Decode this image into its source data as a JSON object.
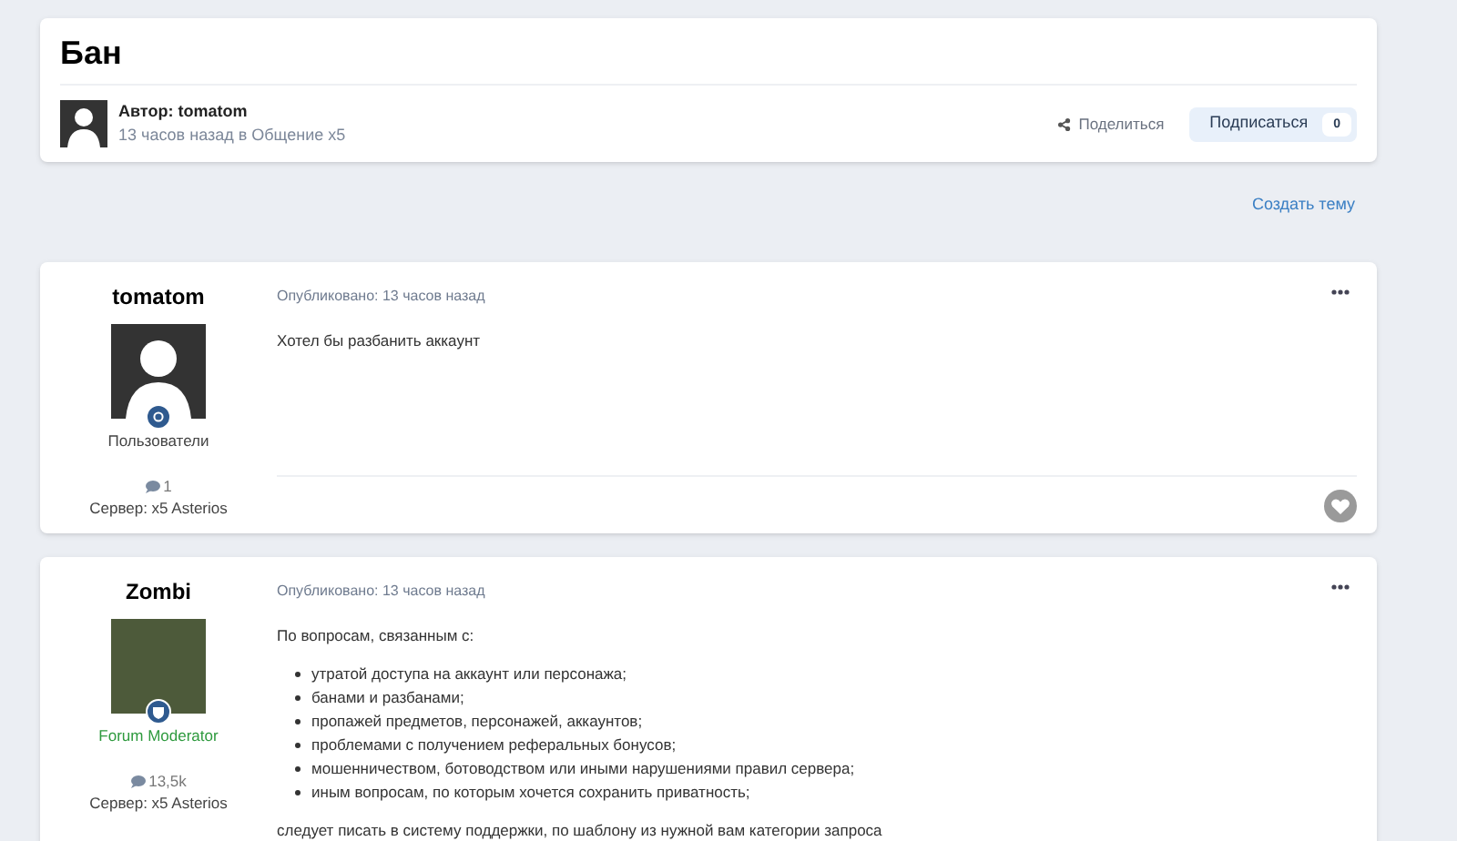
{
  "topic": {
    "title": "Бан",
    "author": "Автор: tomatom",
    "meta": "13 часов назад в Общение x5",
    "share": "Поделиться",
    "subscribe": "Подписаться",
    "subscribe_count": "0"
  },
  "create_topic": "Создать тему",
  "posts": [
    {
      "author": "tomatom",
      "avatar": {
        "kind": "silhouette"
      },
      "group": "Пользователи",
      "color": "#444444",
      "posts_count": "1",
      "server": "Сервер: x5 Asterios",
      "published": "Опубликовано: 13 часов назад",
      "body": [
        {
          "kind": "paragraph",
          "text": "Хотел бы разбанить аккаунт"
        }
      ],
      "footer": true
    },
    {
      "author": "Zombi",
      "avatar": {
        "kind": "photo"
      },
      "group": "Forum Moderator",
      "color": "#2e9a3e",
      "posts_count": "13,5k",
      "server": "Сервер: x5 Asterios",
      "published": "Опубликовано: 13 часов назад",
      "body": [
        {
          "kind": "paragraph",
          "text": "По вопросам, связанным с:"
        },
        {
          "kind": "list",
          "items": [
            "утратой доступа на аккаунт или персонажа;",
            "банами и разбанами;",
            "пропажей предметов, персонажей, аккаунтов;",
            "проблемами с получением реферальных бонусов;",
            "мошенничеством, ботоводством или иными нарушениями правил сервера;",
            "иным вопросам, по которым хочется сохранить приватность;"
          ]
        },
        {
          "kind": "paragraph",
          "text": "следует писать в систему поддержки, по шаблону из нужной вам категории запроса"
        }
      ],
      "footer": false
    }
  ]
}
